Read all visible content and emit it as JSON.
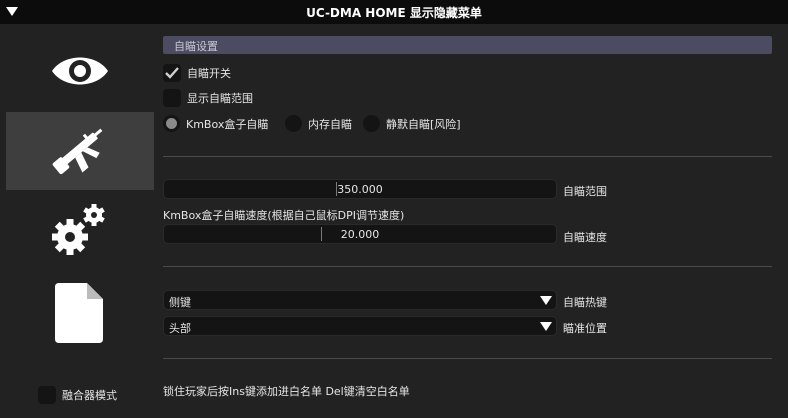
{
  "window": {
    "title": "UC-DMA HOME 显示隐藏菜单"
  },
  "sidebar": {
    "items": [
      {
        "icon": "eye-icon"
      },
      {
        "icon": "rifle-icon",
        "active": true
      },
      {
        "icon": "gears-icon"
      },
      {
        "icon": "document-icon"
      }
    ],
    "fusion_mode": {
      "label": "融合器模式",
      "checked": false
    }
  },
  "aimbot": {
    "section_title": "自瞄设置",
    "enable": {
      "label": "自瞄开关",
      "checked": true
    },
    "show_range": {
      "label": "显示自瞄范围",
      "checked": false
    },
    "modes": [
      {
        "label": "KmBox盒子自瞄",
        "selected": true
      },
      {
        "label": "内存自瞄",
        "selected": false
      },
      {
        "label": "静默自瞄[风险]",
        "selected": false
      }
    ],
    "range": {
      "value": "350.000",
      "label": "自瞄范围",
      "fraction": 0.44
    },
    "speed_note": "KmBox盒子自瞄速度(根据自己鼠标DPI调节速度)",
    "speed": {
      "value": "20.000",
      "label": "自瞄速度",
      "fraction": 0.4
    },
    "hotkey": {
      "value": "侧键",
      "label": "自瞄热键"
    },
    "position": {
      "value": "头部",
      "label": "瞄准位置"
    },
    "footer_note": "锁住玩家后按Ins键添加进白名单 Del键清空白名单"
  },
  "colors": {
    "header": "#4b4b62",
    "active_nav": "#3e3e3e",
    "background": "#222222"
  }
}
